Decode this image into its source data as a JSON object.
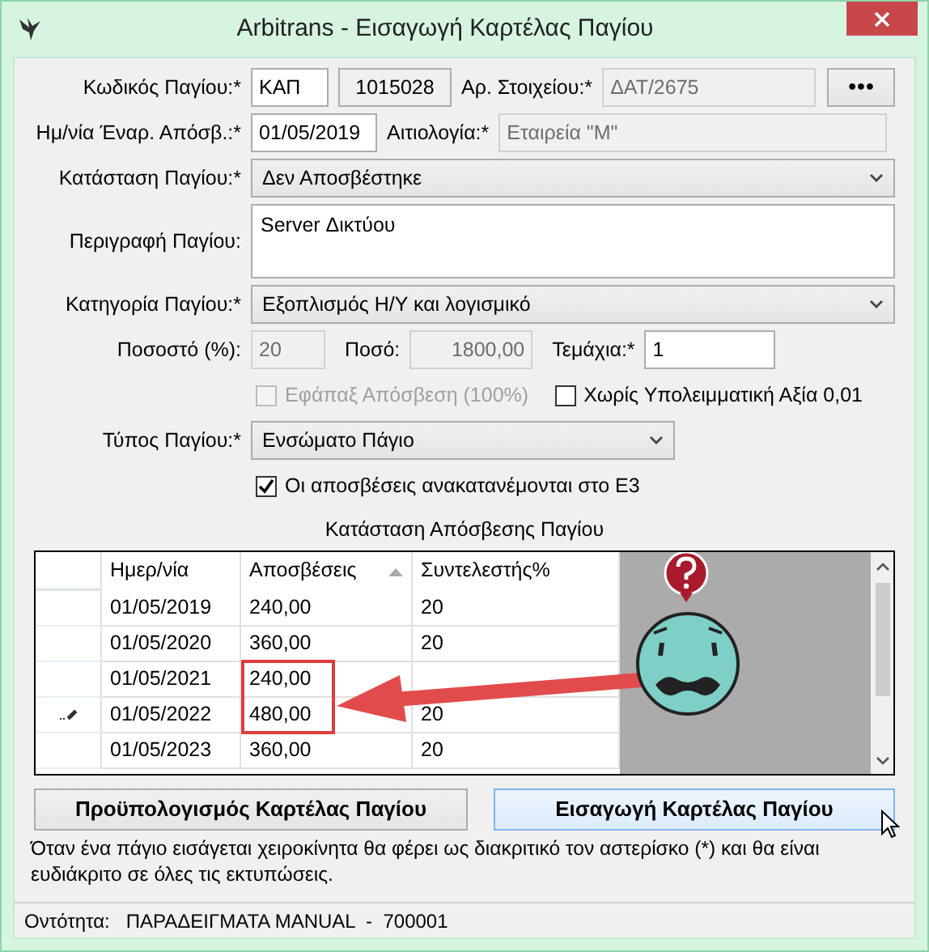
{
  "window": {
    "title": "Arbitrans - Εισαγωγή Καρτέλας Παγίου"
  },
  "rows": [
    [
      {
        "kind": "label",
        "text": "Κωδικός Παγίου:*"
      },
      {
        "kind": "input",
        "value": "ΚΑΠ",
        "disabled": false
      },
      {
        "kind": "readonly",
        "value": "1015028"
      },
      {
        "kind": "label",
        "text": "Αρ. Στοιχείου:*"
      },
      {
        "kind": "input",
        "value": "ΔΑΤ/2675",
        "disabled": true
      },
      {
        "kind": "button",
        "text": "●●●"
      }
    ],
    [
      {
        "kind": "label",
        "text": "Ημ/νία Έναρ. Απόσβ.:*"
      },
      {
        "kind": "input",
        "value": "01/05/2019",
        "disabled": false
      },
      {
        "kind": "label",
        "text": "Αιτιολογία:*"
      },
      {
        "kind": "input",
        "value": "Εταιρεία \"Μ\"",
        "disabled": true
      }
    ],
    [
      {
        "kind": "label",
        "text": "Κατάσταση Παγίου:*"
      },
      {
        "kind": "select",
        "value": "Δεν Αποσβέστηκε"
      }
    ],
    [
      {
        "kind": "label",
        "text": "Περιγραφή Παγίου:"
      },
      {
        "kind": "textarea",
        "value": "Server Δικτύου"
      }
    ],
    [
      {
        "kind": "label",
        "text": "Κατηγορία Παγίου:*"
      },
      {
        "kind": "select",
        "value": "Εξοπλισμός Η/Υ και λογισμικό"
      }
    ],
    [
      {
        "kind": "label",
        "text": "Ποσοστό (%):"
      },
      {
        "kind": "input",
        "value": "20",
        "disabled": true
      },
      {
        "kind": "label",
        "text": "Ποσό:"
      },
      {
        "kind": "input",
        "value": "1800,00",
        "disabled": true
      },
      {
        "kind": "label",
        "text": "Τεμάχια:*"
      },
      {
        "kind": "input",
        "value": "1",
        "disabled": false
      }
    ],
    [
      {
        "kind": "checkbox",
        "text": "Εφάπαξ Απόσβεση (100%)",
        "checked": false,
        "disabled": true
      },
      {
        "kind": "checkbox",
        "text": "Χωρίς Υπολειμματική Αξία 0,01",
        "checked": false,
        "disabled": false
      }
    ],
    [
      {
        "kind": "label",
        "text": "Τύπος Παγίου:*"
      },
      {
        "kind": "select",
        "value": "Ενσώματο Πάγιο"
      }
    ],
    [
      {
        "kind": "checkbox",
        "text": "Οι αποσβέσεις ανακατανέμονται στο Ε3",
        "checked": true,
        "disabled": false
      }
    ]
  ],
  "grid": {
    "title": "Κατάσταση Απόσβεσης Παγίου",
    "columns": [
      {
        "label": "Ημερ/νία",
        "sorted": false
      },
      {
        "label": "Αποσβέσεις",
        "sorted": true
      },
      {
        "label": "Συντελεστής%",
        "sorted": false
      }
    ],
    "rows": [
      {
        "cells": [
          "01/05/2019",
          "240,00",
          "20"
        ],
        "editing": false,
        "highlighted": false
      },
      {
        "cells": [
          "01/05/2020",
          "360,00",
          "20"
        ],
        "editing": false,
        "highlighted": false
      },
      {
        "cells": [
          "01/05/2021",
          "240,00",
          null
        ],
        "editing": false,
        "highlighted": true
      },
      {
        "cells": [
          "01/05/2022",
          "480,00",
          "20"
        ],
        "editing": true,
        "highlighted": true
      },
      {
        "cells": [
          "01/05/2023",
          "360,00",
          "20"
        ],
        "editing": false,
        "highlighted": false
      }
    ]
  },
  "buttons": [
    {
      "text": "Προϋπολογισμός Καρτέλας Παγίου",
      "hovered": false
    },
    {
      "text": "Εισαγωγή Καρτέλας Παγίου",
      "hovered": true
    }
  ],
  "note": "Όταν ένα πάγιο εισάγεται χειροκίνητα θα φέρει ως διακριτικό τον αστερίσκο (*) και θα είναι ευδιάκριτο σε όλες τις εκτυπώσεις.",
  "status_bar": {
    "label": "Οντότητα:",
    "value": "ΠΑΡΑΔΕΙΓΜΑΤΑ MANUAL  -  700001"
  }
}
